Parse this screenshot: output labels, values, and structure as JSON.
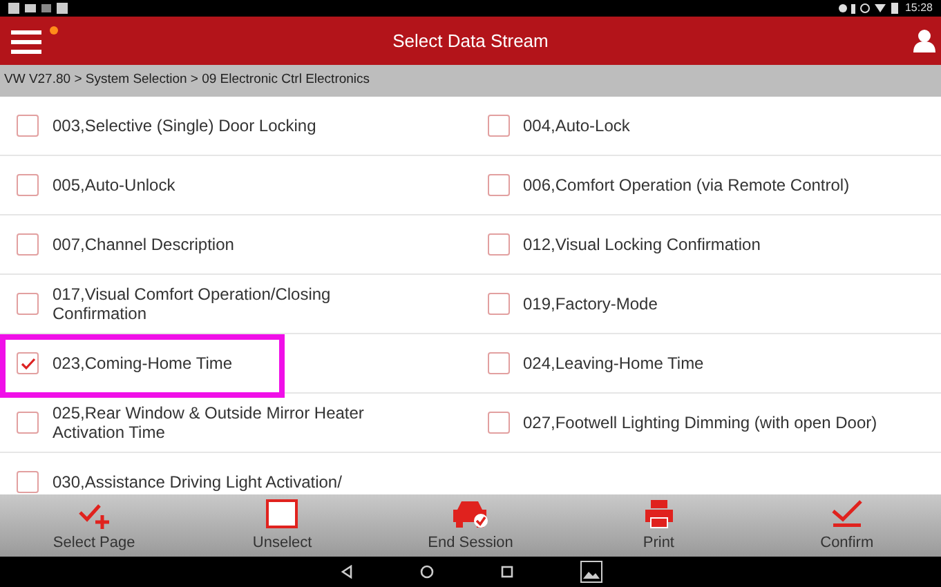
{
  "status_bar": {
    "time": "15:28"
  },
  "header": {
    "title": "Select Data Stream",
    "notification_dot": true
  },
  "breadcrumb": "VW V27.80 > System Selection > 09 Electronic Ctrl Electronics",
  "items": [
    {
      "label": "003,Selective (Single) Door Locking",
      "checked": false,
      "highlighted": false
    },
    {
      "label": "004,Auto-Lock",
      "checked": false,
      "highlighted": false
    },
    {
      "label": "005,Auto-Unlock",
      "checked": false,
      "highlighted": false
    },
    {
      "label": "006,Comfort Operation (via Remote Control)",
      "checked": false,
      "highlighted": false
    },
    {
      "label": "007,Channel Description",
      "checked": false,
      "highlighted": false
    },
    {
      "label": "012,Visual Locking Confirmation",
      "checked": false,
      "highlighted": false
    },
    {
      "label": "017,Visual Comfort Operation/Closing Confirmation",
      "checked": false,
      "highlighted": false
    },
    {
      "label": "019,Factory-Mode",
      "checked": false,
      "highlighted": false
    },
    {
      "label": "023,Coming-Home Time",
      "checked": true,
      "highlighted": true
    },
    {
      "label": "024,Leaving-Home Time",
      "checked": false,
      "highlighted": false
    },
    {
      "label": "025,Rear Window & Outside Mirror Heater Activation Time",
      "checked": false,
      "highlighted": false
    },
    {
      "label": "027,Footwell Lighting Dimming (with open Door)",
      "checked": false,
      "highlighted": false
    },
    {
      "label": "030,Assistance Driving Light Activation/",
      "checked": false,
      "highlighted": false
    }
  ],
  "toolbar": [
    {
      "kind": "select-page",
      "label": "Select Page"
    },
    {
      "kind": "unselect",
      "label": "Unselect"
    },
    {
      "kind": "end-session",
      "label": "End Session"
    },
    {
      "kind": "print",
      "label": "Print"
    },
    {
      "kind": "confirm",
      "label": "Confirm"
    }
  ]
}
